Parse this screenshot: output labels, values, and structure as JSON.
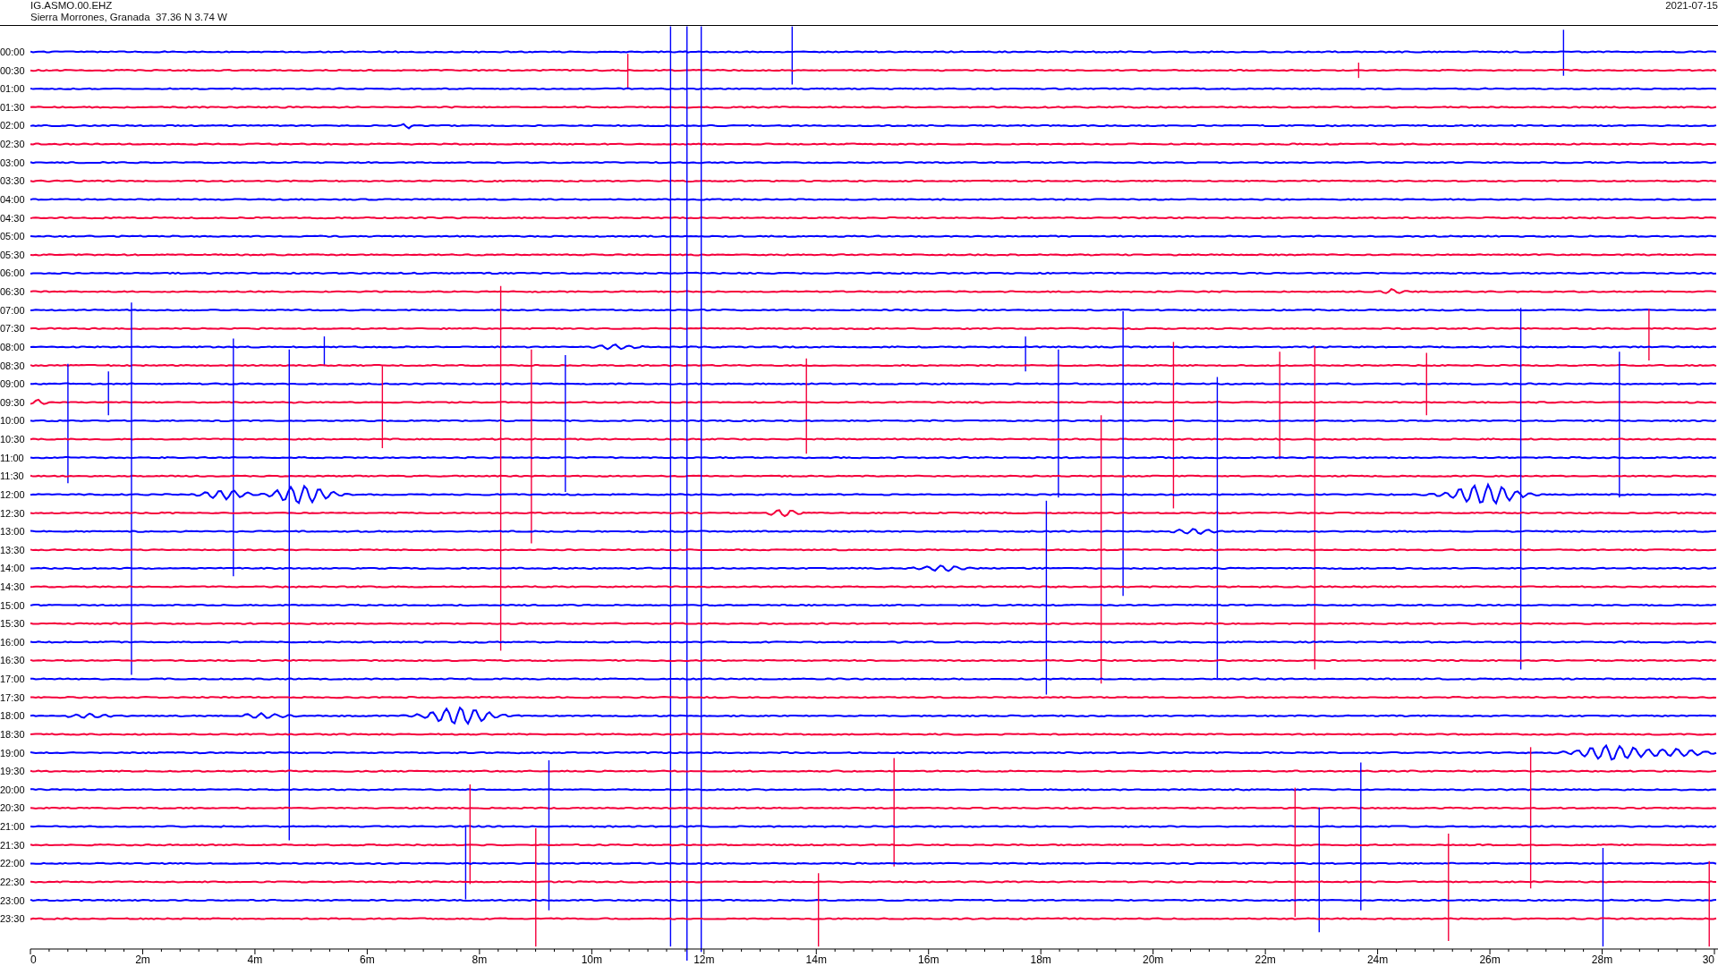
{
  "header": {
    "station": "IG.ASMO.00.EHZ",
    "location": "Sierra Morrones, Granada  37.36 N 3.74 W",
    "date": "2021-07-15"
  },
  "rows": [
    {
      "label": "00:00",
      "color": "#0000ff"
    },
    {
      "label": "00:30",
      "color": "#f5003c"
    },
    {
      "label": "01:00",
      "color": "#0000ff"
    },
    {
      "label": "01:30",
      "color": "#f5003c"
    },
    {
      "label": "02:00",
      "color": "#0000ff"
    },
    {
      "label": "02:30",
      "color": "#f5003c"
    },
    {
      "label": "03:00",
      "color": "#0000ff"
    },
    {
      "label": "03:30",
      "color": "#f5003c"
    },
    {
      "label": "04:00",
      "color": "#0000ff"
    },
    {
      "label": "04:30",
      "color": "#f5003c"
    },
    {
      "label": "05:00",
      "color": "#0000ff"
    },
    {
      "label": "05:30",
      "color": "#f5003c"
    },
    {
      "label": "06:00",
      "color": "#0000ff"
    },
    {
      "label": "06:30",
      "color": "#f5003c"
    },
    {
      "label": "07:00",
      "color": "#0000ff"
    },
    {
      "label": "07:30",
      "color": "#f5003c"
    },
    {
      "label": "08:00",
      "color": "#0000ff"
    },
    {
      "label": "08:30",
      "color": "#f5003c"
    },
    {
      "label": "09:00",
      "color": "#0000ff"
    },
    {
      "label": "09:30",
      "color": "#f5003c"
    },
    {
      "label": "10:00",
      "color": "#0000ff"
    },
    {
      "label": "10:30",
      "color": "#f5003c"
    },
    {
      "label": "11:00",
      "color": "#0000ff"
    },
    {
      "label": "11:30",
      "color": "#f5003c"
    },
    {
      "label": "12:00",
      "color": "#0000ff"
    },
    {
      "label": "12:30",
      "color": "#f5003c"
    },
    {
      "label": "13:00",
      "color": "#0000ff"
    },
    {
      "label": "13:30",
      "color": "#f5003c"
    },
    {
      "label": "14:00",
      "color": "#0000ff"
    },
    {
      "label": "14:30",
      "color": "#f5003c"
    },
    {
      "label": "15:00",
      "color": "#0000ff"
    },
    {
      "label": "15:30",
      "color": "#f5003c"
    },
    {
      "label": "16:00",
      "color": "#0000ff"
    },
    {
      "label": "16:30",
      "color": "#f5003c"
    },
    {
      "label": "17:00",
      "color": "#0000ff"
    },
    {
      "label": "17:30",
      "color": "#f5003c"
    },
    {
      "label": "18:00",
      "color": "#0000ff"
    },
    {
      "label": "18:30",
      "color": "#f5003c"
    },
    {
      "label": "19:00",
      "color": "#0000ff"
    },
    {
      "label": "19:30",
      "color": "#f5003c"
    },
    {
      "label": "20:00",
      "color": "#0000ff"
    },
    {
      "label": "20:30",
      "color": "#f5003c"
    },
    {
      "label": "21:00",
      "color": "#0000ff"
    },
    {
      "label": "21:30",
      "color": "#f5003c"
    },
    {
      "label": "22:00",
      "color": "#0000ff"
    },
    {
      "label": "22:30",
      "color": "#f5003c"
    },
    {
      "label": "23:00",
      "color": "#0000ff"
    },
    {
      "label": "23:30",
      "color": "#f5003c"
    }
  ],
  "x_axis": {
    "tick_labels": [
      "0",
      "2m",
      "4m",
      "6m",
      "8m",
      "10m",
      "12m",
      "14m",
      "16m",
      "18m",
      "20m",
      "22m",
      "24m",
      "26m",
      "28m",
      "30"
    ]
  }
}
